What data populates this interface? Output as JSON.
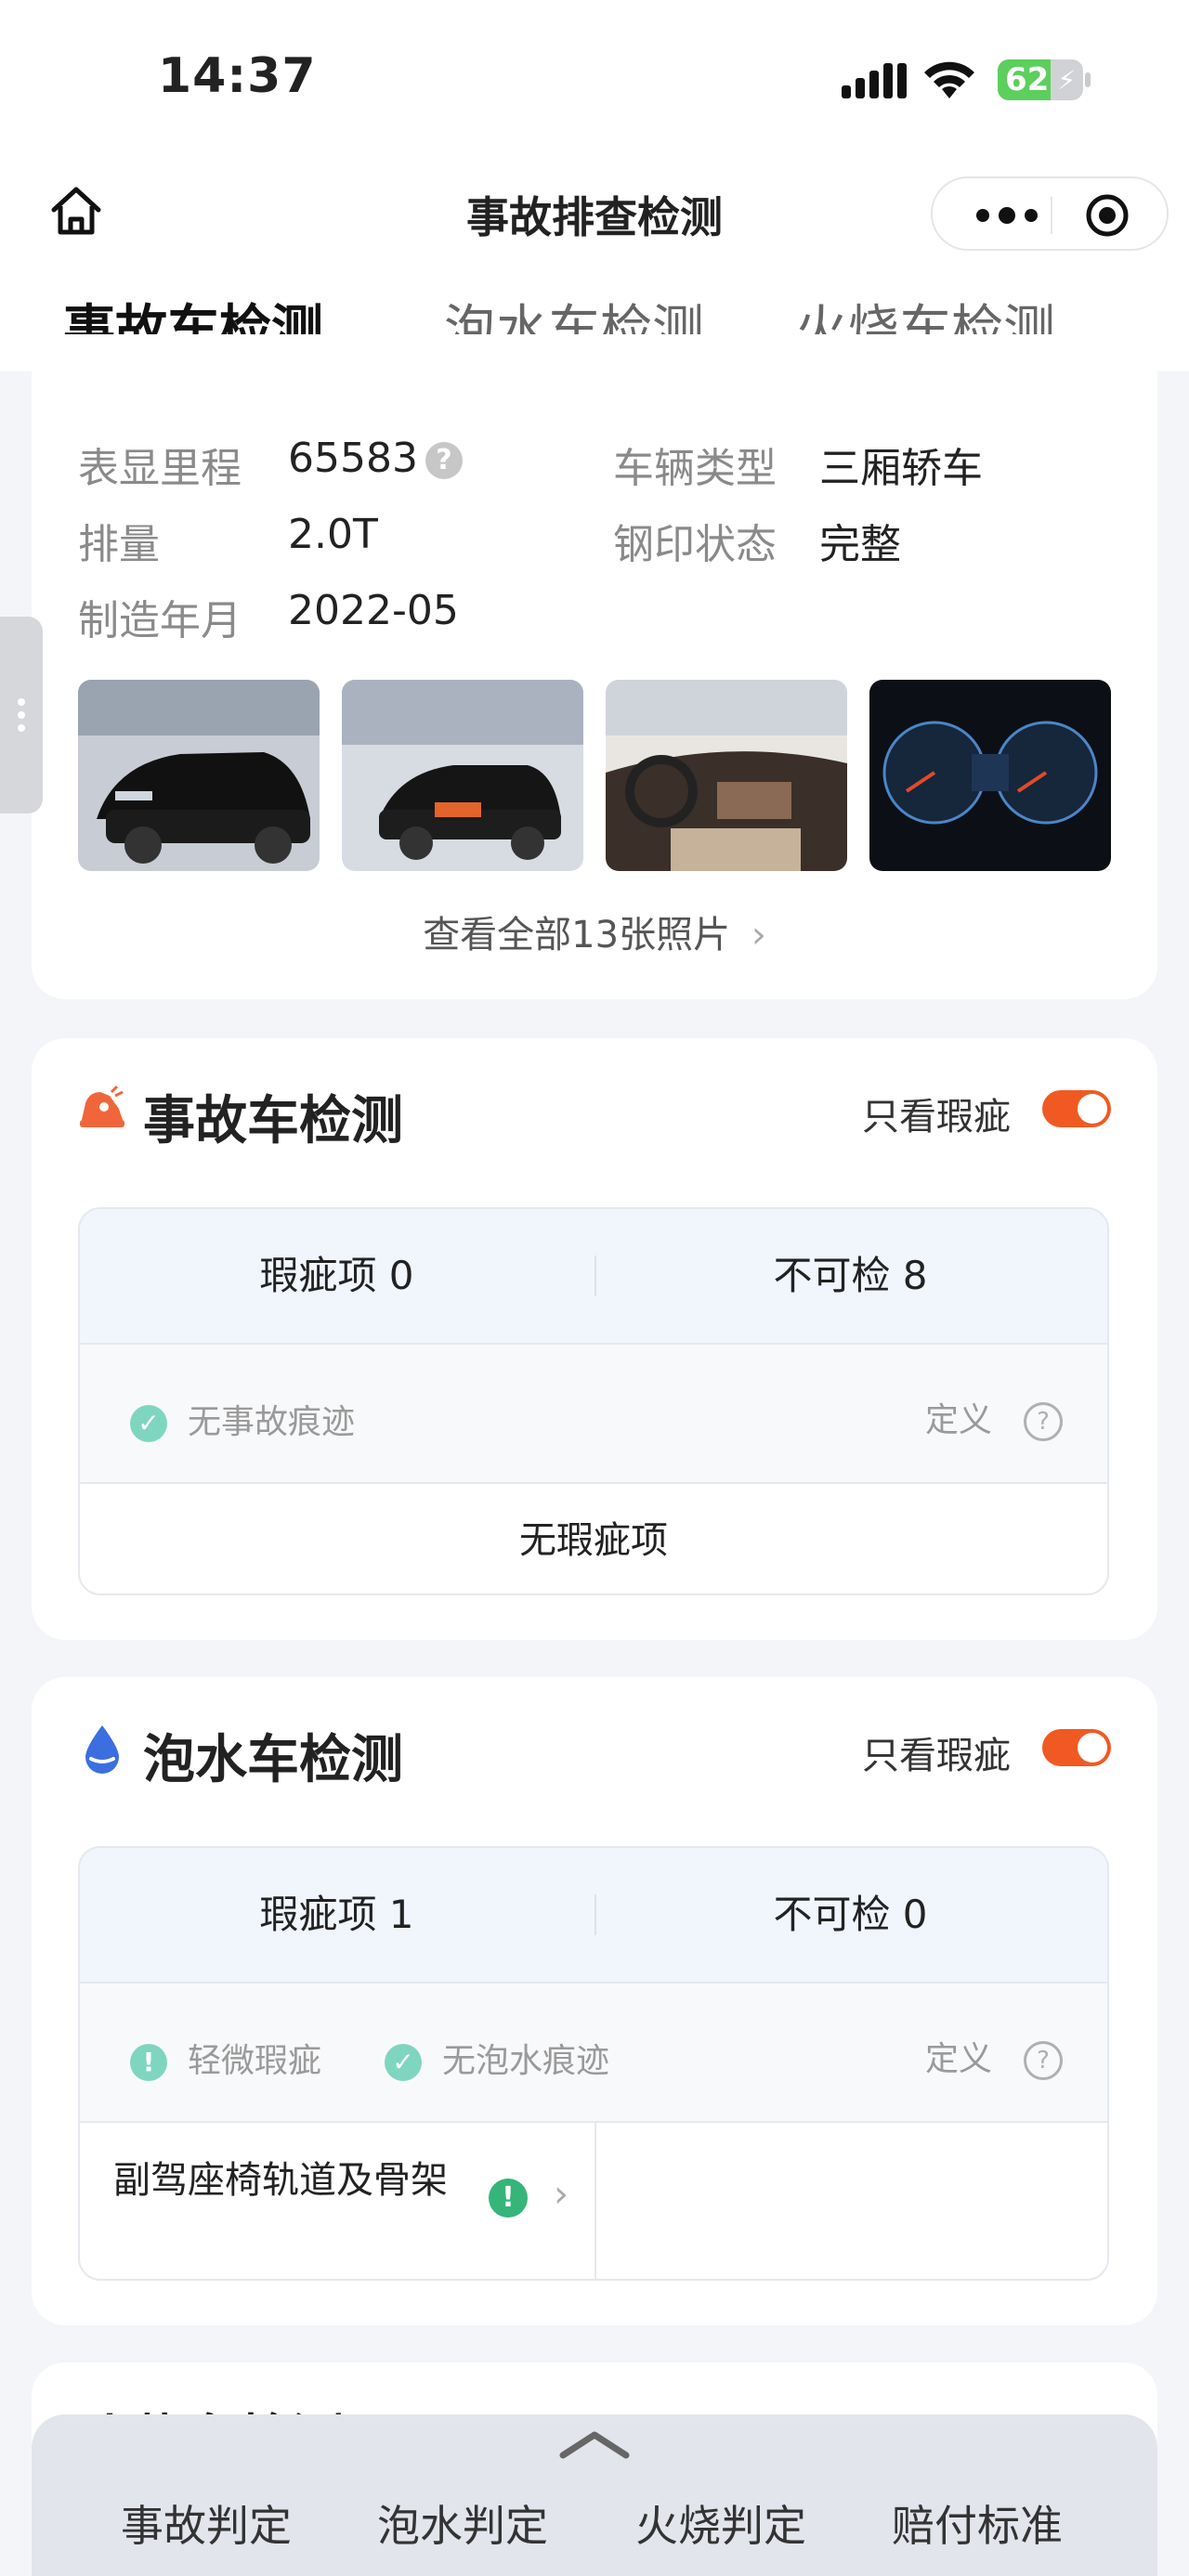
{
  "status_bar": {
    "time": "14:37",
    "battery": "62",
    "battery_level": 0.62
  },
  "nav": {
    "title": "事故排查检测"
  },
  "tabs": [
    {
      "label": "事故车检测"
    },
    {
      "label": "泡水车检测"
    },
    {
      "label": "火烧车检测"
    }
  ],
  "vehicle_info": {
    "fields": [
      {
        "label": "表显里程",
        "value": "65583"
      },
      {
        "label": "车辆类型",
        "value": "三厢轿车"
      },
      {
        "label": "排量",
        "value": "2.0T"
      },
      {
        "label": "钢印状态",
        "value": "完整"
      },
      {
        "label": "制造年月",
        "value": "2022-05"
      }
    ],
    "view_all": "查看全部13张照片"
  },
  "accident": {
    "title": "事故车检测",
    "toggle_label": "只看瑕疵",
    "flaw_count": "瑕疵项 0",
    "uncheckable": "不可检 8",
    "legend_ok": "无事故痕迹",
    "definition": "定义",
    "empty_text": "无瑕疵项"
  },
  "flood": {
    "title": "泡水车检测",
    "toggle_label": "只看瑕疵",
    "flaw_count": "瑕疵项 1",
    "uncheckable": "不可检 0",
    "legend_warn": "轻微瑕疵",
    "legend_ok": "无泡水痕迹",
    "definition": "定义",
    "item_name": "副驾座椅轨道及骨架"
  },
  "fire": {
    "title": "火烧车检测"
  },
  "bottom_nav": [
    {
      "label": "事故判定"
    },
    {
      "label": "泡水判定"
    },
    {
      "label": "火烧判定"
    },
    {
      "label": "赔付标准"
    }
  ],
  "colors": {
    "accent": "#f05a22",
    "ok": "#7fd6c0",
    "warn": "#35b57a",
    "water": "#3b6fe0"
  }
}
